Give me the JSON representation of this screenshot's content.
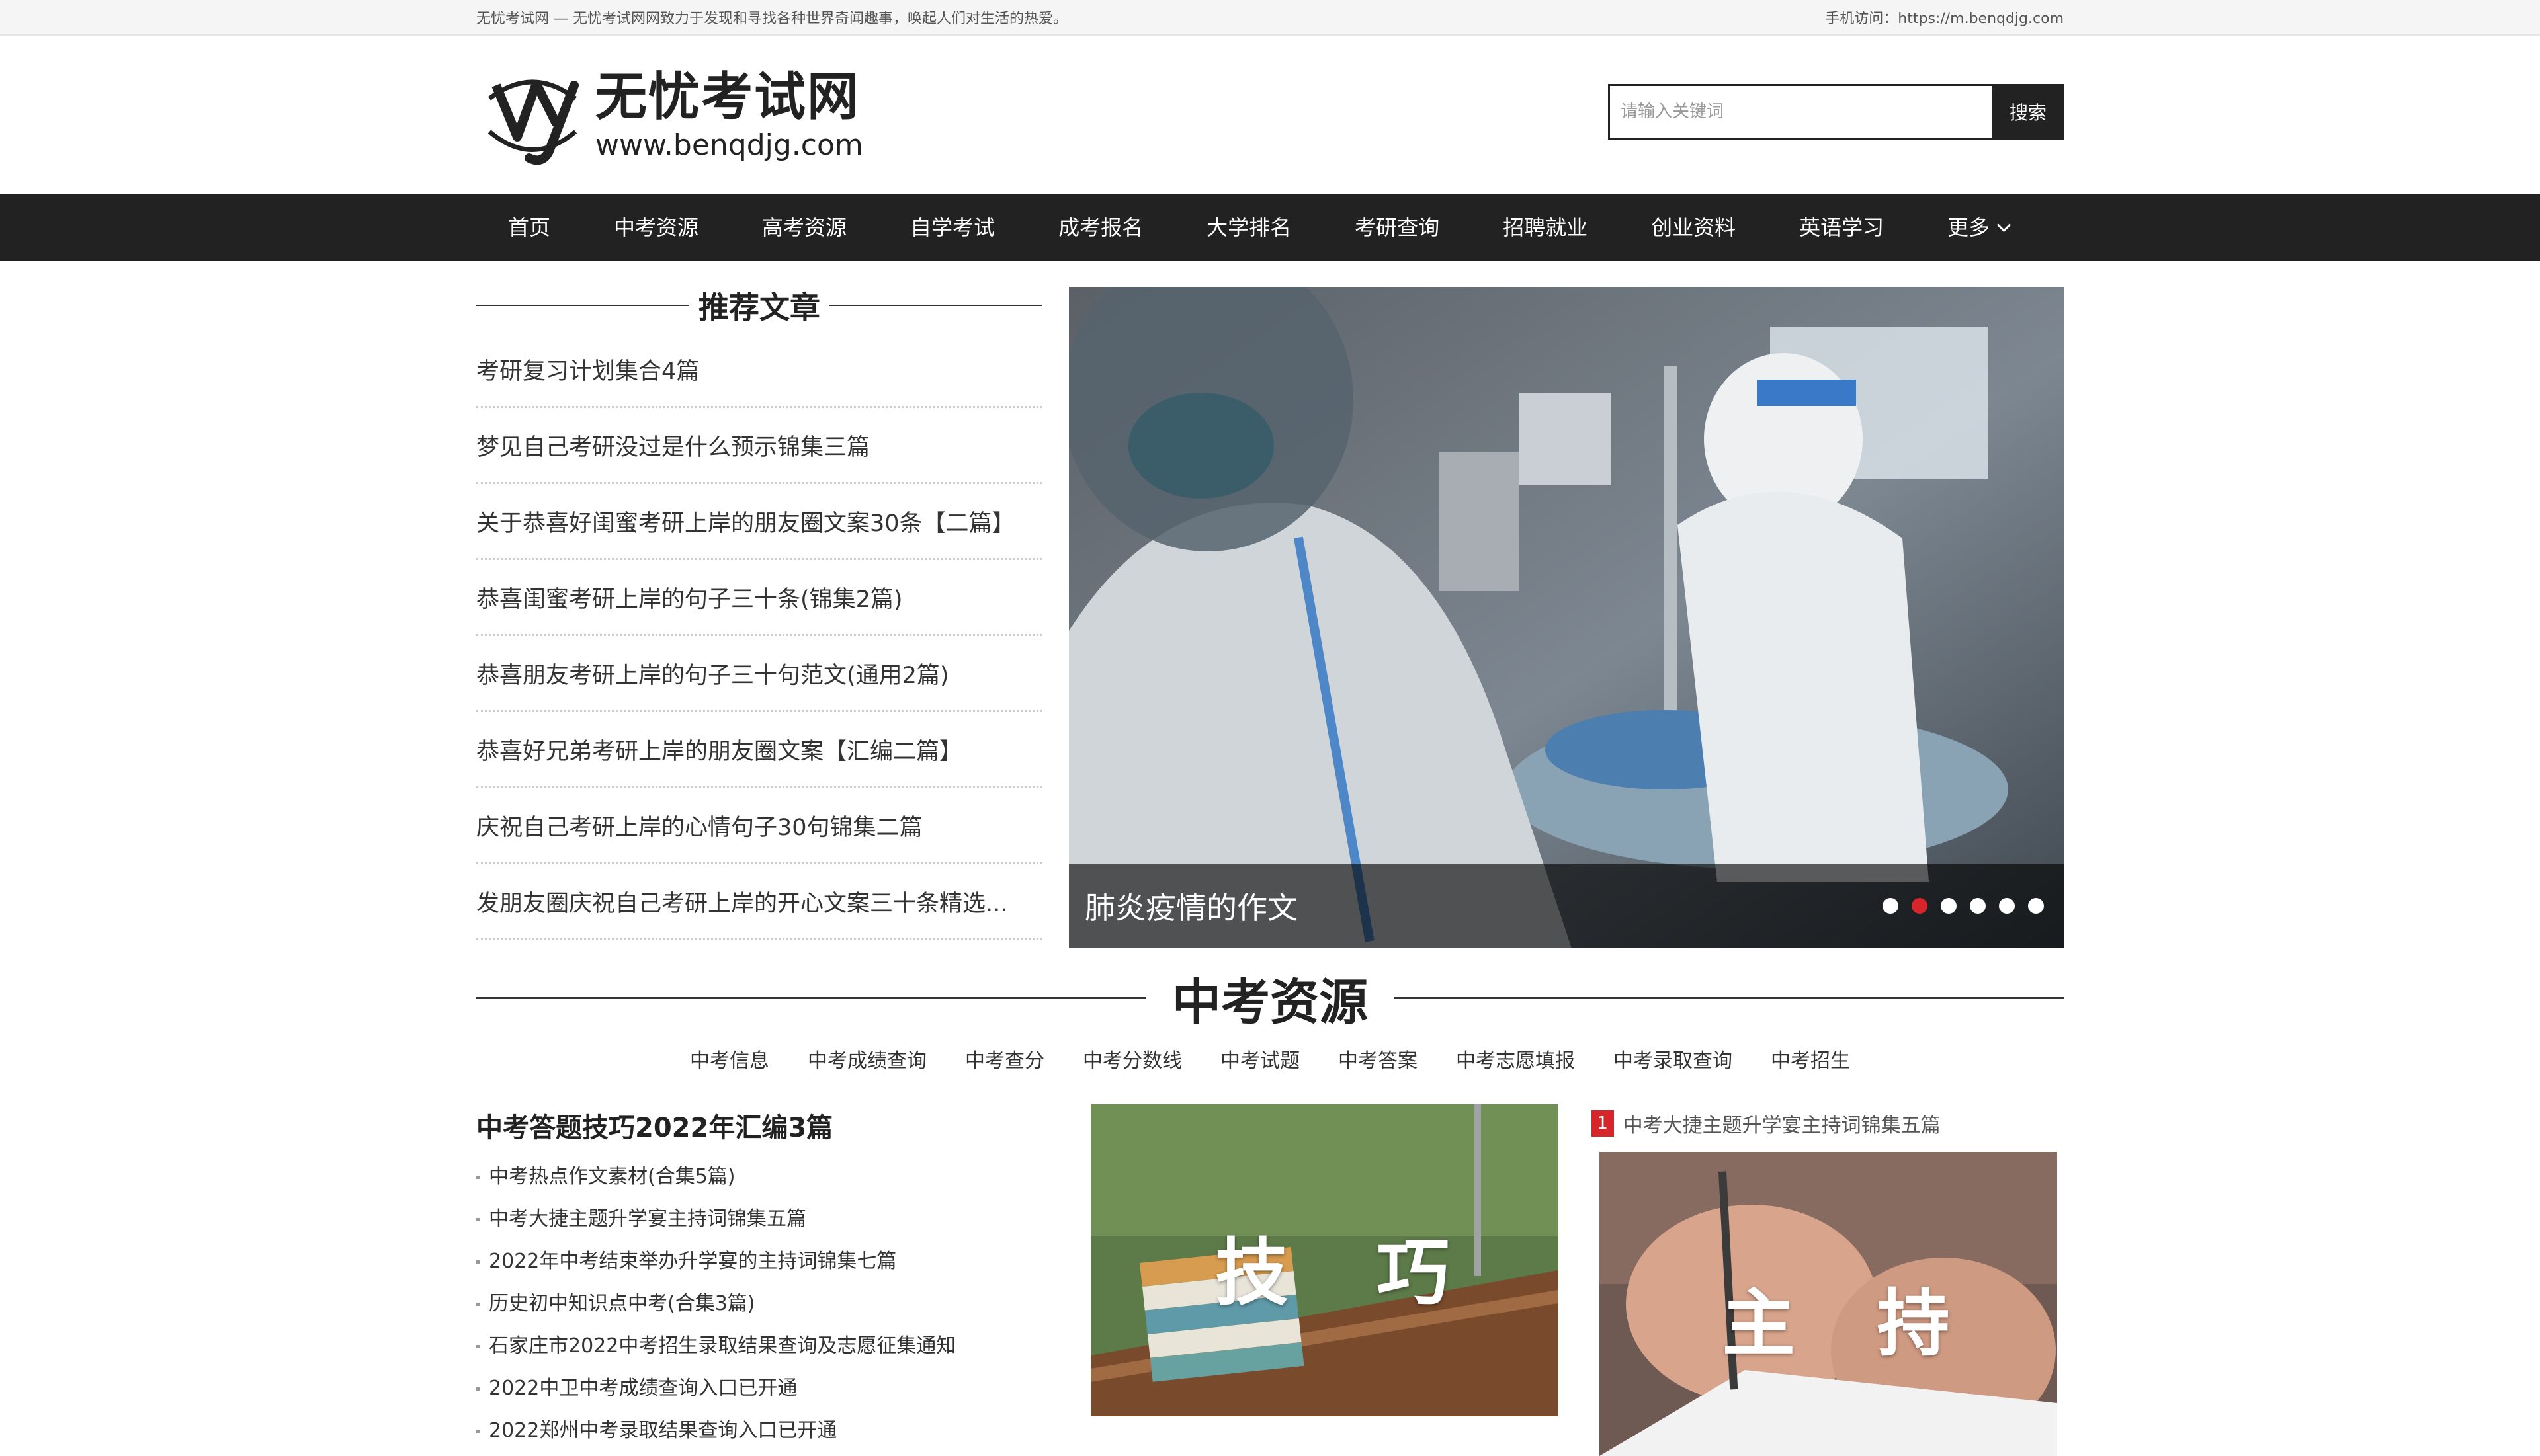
{
  "topbar": {
    "left_text": "无忧考试网 — 无忧考试网网致力于发现和寻找各种世界奇闻趣事，唤起人们对生活的热爱。",
    "right_text": "手机访问：https://m.benqdjg.com"
  },
  "header": {
    "logo_name": "无忧考试网",
    "logo_url": "www.benqdjg.com",
    "search_placeholder": "请输入关键词",
    "search_button": "搜索"
  },
  "nav": {
    "items": [
      "首页",
      "中考资源",
      "高考资源",
      "自学考试",
      "成考报名",
      "大学排名",
      "考研查询",
      "招聘就业",
      "创业资料",
      "英语学习"
    ],
    "more_label": "更多"
  },
  "recommended": {
    "title": "推荐文章",
    "items": [
      "考研复习计划集合4篇",
      "梦见自己考研没过是什么预示锦集三篇",
      "关于恭喜好闺蜜考研上岸的朋友圈文案30条【二篇】",
      "恭喜闺蜜考研上岸的句子三十条(锦集2篇)",
      "恭喜朋友考研上岸的句子三十句范文(通用2篇)",
      "恭喜好兄弟考研上岸的朋友圈文案【汇编二篇】",
      "庆祝自己考研上岸的心情句子30句锦集二篇",
      "发朋友圈庆祝自己考研上岸的开心文案三十条精选..."
    ]
  },
  "slider": {
    "caption": "肺炎疫情的作文",
    "dot_count": 6,
    "active_dot": 2
  },
  "section": {
    "title": "中考资源",
    "subnav": [
      "中考信息",
      "中考成绩查询",
      "中考查分",
      "中考分数线",
      "中考试题",
      "中考答案",
      "中考志愿填报",
      "中考录取查询",
      "中考招生"
    ],
    "main_title": "中考答题技巧2022年汇编3篇",
    "list": [
      "中考热点作文素材(合集5篇)",
      "中考大捷主题升学宴主持词锦集五篇",
      "2022年中考结束举办升学宴的主持词锦集七篇",
      "历史初中知识点中考(合集3篇)",
      "石家庄市2022中考招生录取结果查询及志愿征集通知",
      "2022中卫中考成绩查询入口已开通",
      "2022郑州中考录取结果查询入口已开通"
    ],
    "thumb1_words": [
      "技",
      "巧"
    ],
    "col3_badge": "1",
    "col3_title": "中考大捷主题升学宴主持词锦集五篇",
    "thumb2_words": [
      "主",
      "持"
    ]
  }
}
